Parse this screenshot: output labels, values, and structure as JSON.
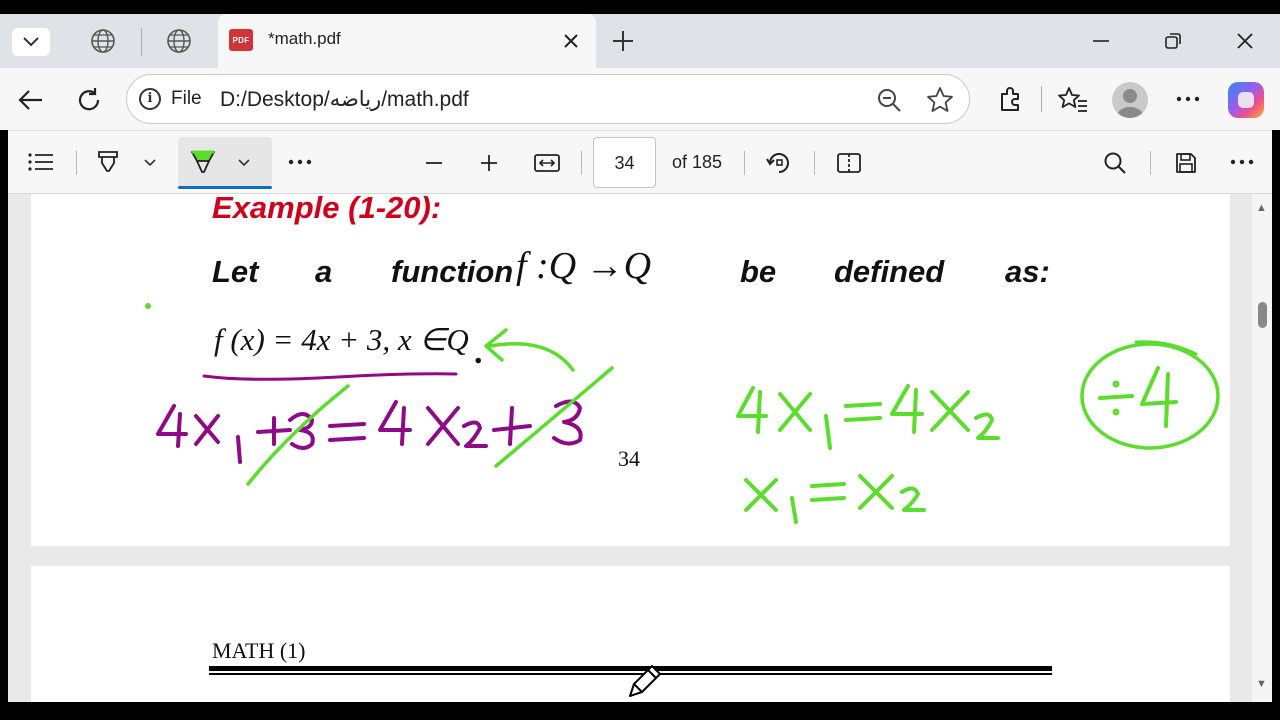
{
  "browser": {
    "tab_title": "*math.pdf",
    "tab_pdf_badge": "PDF",
    "address_scheme": "File",
    "address_url": "D:/Desktop/رياضه/math.pdf"
  },
  "pdf_toolbar": {
    "current_page": "34",
    "page_of": "of 185"
  },
  "page1": {
    "example_title": "Example (1-20):",
    "line_words": [
      "Let",
      "a",
      "function",
      "be",
      "defined",
      "as:"
    ],
    "map_expr": "f :Q →Q",
    "def_expr": "f (x) = 4x + 3, x ∈Q",
    "def_dot": ".",
    "page_number": "34"
  },
  "page2": {
    "header": "MATH (1)"
  },
  "annotations": {
    "colors": {
      "purple": "#8e0a86",
      "green": "#5cdc2c"
    }
  },
  "icons": [
    "chevron-down-icon",
    "globe-icon",
    "close-icon",
    "plus-icon",
    "minimize-icon",
    "restore-icon",
    "back-icon",
    "refresh-icon",
    "info-icon",
    "zoom-out-icon",
    "star-icon",
    "extensions-icon",
    "favorites-icon",
    "more-icon",
    "contents-icon",
    "draw-icon",
    "highlight-icon",
    "fit-width-icon",
    "rotate-icon",
    "page-view-icon",
    "search-icon",
    "save-icon",
    "pen-cursor-icon"
  ]
}
